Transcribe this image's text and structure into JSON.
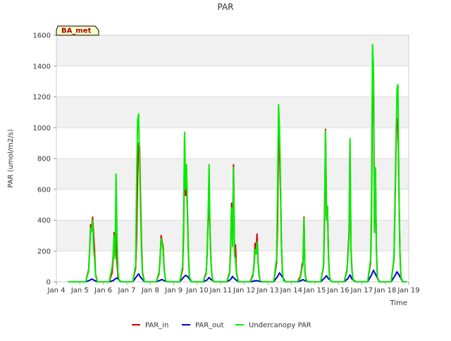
{
  "chart_data": {
    "type": "line",
    "title": "PAR",
    "xlabel": "Time",
    "ylabel": "PAR (umol/m2/s)",
    "site_tag": "BA_met",
    "xlim": [
      "Jan 4",
      "Jan 19"
    ],
    "ylim": [
      0,
      1600
    ],
    "x_ticks": [
      "Jan 4",
      "Jan 5",
      "Jan 6",
      "Jan 7",
      "Jan 8",
      "Jan 9",
      "Jan 10",
      "Jan 11",
      "Jan 12",
      "Jan 13",
      "Jan 14",
      "Jan 15",
      "Jan 16",
      "Jan 17",
      "Jan 18",
      "Jan 19"
    ],
    "y_ticks": [
      0,
      200,
      400,
      600,
      800,
      1000,
      1200,
      1400,
      1600
    ],
    "grid": true,
    "legend_position": "bottom",
    "series": [
      {
        "name": "PAR_in",
        "color": "#dd0000",
        "x": [
          "Jan 4 12:00",
          "Jan 4 18:00",
          "Jan 5 00:00",
          "Jan 5 06:00",
          "Jan 5 09:00",
          "Jan 5 10:00",
          "Jan 5 11:00",
          "Jan 5 12:00",
          "Jan 5 13:00",
          "Jan 5 14:00",
          "Jan 5 15:00",
          "Jan 5 16:00",
          "Jan 5 18:00",
          "Jan 6 06:00",
          "Jan 6 09:00",
          "Jan 6 10:00",
          "Jan 6 11:00",
          "Jan 6 12:00",
          "Jan 6 13:00",
          "Jan 6 14:00",
          "Jan 6 15:00",
          "Jan 6 16:00",
          "Jan 6 18:00",
          "Jan 7 06:00",
          "Jan 7 09:00",
          "Jan 7 10:00",
          "Jan 7 11:00",
          "Jan 7 12:00",
          "Jan 7 13:00",
          "Jan 7 14:00",
          "Jan 7 15:00",
          "Jan 7 16:00",
          "Jan 7 18:00",
          "Jan 8 06:00",
          "Jan 8 09:00",
          "Jan 8 10:00",
          "Jan 8 11:00",
          "Jan 8 12:00",
          "Jan 8 13:00",
          "Jan 8 14:00",
          "Jan 8 15:00",
          "Jan 8 16:00",
          "Jan 8 18:00",
          "Jan 9 06:00",
          "Jan 9 09:00",
          "Jan 9 10:00",
          "Jan 9 11:00",
          "Jan 9 12:00",
          "Jan 9 13:00",
          "Jan 9 14:00",
          "Jan 9 15:00",
          "Jan 9 16:00",
          "Jan 9 18:00",
          "Jan 10 06:00",
          "Jan 10 09:00",
          "Jan 10 10:00",
          "Jan 10 11:00",
          "Jan 10 12:00",
          "Jan 10 13:00",
          "Jan 10 14:00",
          "Jan 10 15:00",
          "Jan 10 16:00",
          "Jan 10 18:00",
          "Jan 11 06:00",
          "Jan 11 09:00",
          "Jan 11 10:00",
          "Jan 11 11:00",
          "Jan 11 12:00",
          "Jan 11 13:00",
          "Jan 11 14:00",
          "Jan 11 15:00",
          "Jan 11 16:00",
          "Jan 11 18:00",
          "Jan 12 06:00",
          "Jan 12 09:00",
          "Jan 12 10:00",
          "Jan 12 11:00",
          "Jan 12 12:00",
          "Jan 12 13:00",
          "Jan 12 14:00",
          "Jan 12 15:00",
          "Jan 12 16:00",
          "Jan 12 18:00",
          "Jan 13 06:00",
          "Jan 13 09:00",
          "Jan 13 10:00",
          "Jan 13 11:00",
          "Jan 13 12:00",
          "Jan 13 13:00",
          "Jan 13 14:00",
          "Jan 13 15:00",
          "Jan 13 16:00",
          "Jan 13 18:00",
          "Jan 14 06:00",
          "Jan 14 09:00",
          "Jan 14 10:00",
          "Jan 14 11:00",
          "Jan 14 12:00",
          "Jan 14 13:00",
          "Jan 14 14:00",
          "Jan 14 15:00",
          "Jan 14 16:00",
          "Jan 14 18:00",
          "Jan 15 06:00",
          "Jan 15 09:00",
          "Jan 15 10:00",
          "Jan 15 11:00",
          "Jan 15 12:00",
          "Jan 15 13:00",
          "Jan 15 14:00",
          "Jan 15 15:00",
          "Jan 15 16:00",
          "Jan 15 18:00",
          "Jan 16 06:00",
          "Jan 16 09:00",
          "Jan 16 10:00",
          "Jan 16 11:00",
          "Jan 16 12:00",
          "Jan 16 13:00",
          "Jan 16 14:00",
          "Jan 16 15:00",
          "Jan 16 16:00",
          "Jan 16 18:00",
          "Jan 17 06:00",
          "Jan 17 09:00",
          "Jan 17 10:00",
          "Jan 17 11:00",
          "Jan 17 12:00",
          "Jan 17 13:00",
          "Jan 17 14:00",
          "Jan 17 15:00",
          "Jan 17 16:00",
          "Jan 17 18:00",
          "Jan 18 06:00",
          "Jan 18 09:00",
          "Jan 18 10:00",
          "Jan 18 11:00",
          "Jan 18 12:00",
          "Jan 18 13:00",
          "Jan 18 14:00",
          "Jan 18 15:00",
          "Jan 18 16:00",
          "Jan 18 18:00",
          "Jan 18 22:00"
        ],
        "y": [
          0,
          0,
          0,
          0,
          80,
          210,
          370,
          340,
          420,
          310,
          200,
          50,
          0,
          0,
          60,
          150,
          320,
          170,
          310,
          120,
          30,
          10,
          0,
          0,
          90,
          300,
          680,
          900,
          880,
          540,
          250,
          60,
          0,
          0,
          60,
          160,
          300,
          260,
          230,
          100,
          30,
          5,
          0,
          0,
          80,
          320,
          940,
          560,
          680,
          420,
          160,
          30,
          0,
          0,
          60,
          170,
          400,
          500,
          330,
          130,
          40,
          5,
          0,
          0,
          60,
          220,
          510,
          260,
          760,
          200,
          240,
          60,
          0,
          0,
          50,
          120,
          250,
          200,
          310,
          150,
          50,
          10,
          0,
          0,
          120,
          380,
          950,
          850,
          600,
          230,
          60,
          10,
          0,
          0,
          30,
          60,
          110,
          130,
          420,
          60,
          20,
          5,
          0,
          0,
          100,
          400,
          990,
          420,
          490,
          180,
          40,
          10,
          0,
          0,
          80,
          200,
          310,
          900,
          220,
          80,
          20,
          5,
          0,
          0,
          120,
          420,
          1280,
          1360,
          340,
          720,
          200,
          30,
          0,
          0,
          150,
          500,
          860,
          1050,
          1060,
          600,
          200,
          30,
          0,
          0
        ]
      },
      {
        "name": "PAR_out",
        "color": "#0000cc",
        "x": [
          "Jan 4 12:00",
          "Jan 5 06:00",
          "Jan 5 10:00",
          "Jan 5 12:00",
          "Jan 5 14:00",
          "Jan 5 18:00",
          "Jan 6 06:00",
          "Jan 6 10:00",
          "Jan 6 12:00",
          "Jan 6 14:00",
          "Jan 6 18:00",
          "Jan 7 06:00",
          "Jan 7 10:00",
          "Jan 7 12:00",
          "Jan 7 14:00",
          "Jan 7 18:00",
          "Jan 8 06:00",
          "Jan 8 10:00",
          "Jan 8 12:00",
          "Jan 8 14:00",
          "Jan 8 18:00",
          "Jan 9 06:00",
          "Jan 9 10:00",
          "Jan 9 12:00",
          "Jan 9 14:00",
          "Jan 9 18:00",
          "Jan 10 06:00",
          "Jan 10 10:00",
          "Jan 10 12:00",
          "Jan 10 14:00",
          "Jan 10 18:00",
          "Jan 11 06:00",
          "Jan 11 10:00",
          "Jan 11 12:00",
          "Jan 11 14:00",
          "Jan 11 18:00",
          "Jan 12 06:00",
          "Jan 12 10:00",
          "Jan 12 12:00",
          "Jan 12 14:00",
          "Jan 12 18:00",
          "Jan 13 06:00",
          "Jan 13 10:00",
          "Jan 13 12:00",
          "Jan 13 14:00",
          "Jan 13 18:00",
          "Jan 14 06:00",
          "Jan 14 10:00",
          "Jan 14 12:00",
          "Jan 14 14:00",
          "Jan 14 18:00",
          "Jan 15 06:00",
          "Jan 15 10:00",
          "Jan 15 12:00",
          "Jan 15 14:00",
          "Jan 15 18:00",
          "Jan 16 06:00",
          "Jan 16 10:00",
          "Jan 16 12:00",
          "Jan 16 14:00",
          "Jan 16 18:00",
          "Jan 17 06:00",
          "Jan 17 10:00",
          "Jan 17 12:00",
          "Jan 17 14:00",
          "Jan 17 18:00",
          "Jan 18 06:00",
          "Jan 18 10:00",
          "Jan 18 12:00",
          "Jan 18 14:00",
          "Jan 18 18:00",
          "Jan 18 22:00"
        ],
        "y": [
          0,
          0,
          10,
          18,
          12,
          0,
          0,
          8,
          18,
          25,
          0,
          0,
          35,
          52,
          30,
          0,
          0,
          10,
          15,
          8,
          0,
          0,
          30,
          42,
          35,
          0,
          0,
          12,
          28,
          15,
          0,
          0,
          15,
          35,
          20,
          0,
          0,
          5,
          8,
          6,
          0,
          0,
          35,
          58,
          40,
          0,
          0,
          8,
          14,
          8,
          0,
          0,
          25,
          40,
          20,
          0,
          0,
          22,
          45,
          18,
          0,
          0,
          45,
          75,
          50,
          0,
          0,
          40,
          65,
          45,
          0,
          0
        ]
      },
      {
        "name": "Undercanopy PAR",
        "color": "#00ee00",
        "x": [
          "Jan 4 12:00",
          "Jan 4 18:00",
          "Jan 5 00:00",
          "Jan 5 06:00",
          "Jan 5 09:00",
          "Jan 5 10:00",
          "Jan 5 11:00",
          "Jan 5 12:00",
          "Jan 5 13:00",
          "Jan 5 14:00",
          "Jan 5 15:00",
          "Jan 5 16:00",
          "Jan 5 18:00",
          "Jan 6 06:00",
          "Jan 6 09:00",
          "Jan 6 10:00",
          "Jan 6 11:00",
          "Jan 6 12:00",
          "Jan 6 13:00",
          "Jan 6 14:00",
          "Jan 6 15:00",
          "Jan 6 16:00",
          "Jan 6 18:00",
          "Jan 7 06:00",
          "Jan 7 09:00",
          "Jan 7 10:00",
          "Jan 7 11:00",
          "Jan 7 12:00",
          "Jan 7 13:00",
          "Jan 7 14:00",
          "Jan 7 15:00",
          "Jan 7 16:00",
          "Jan 7 18:00",
          "Jan 8 06:00",
          "Jan 8 09:00",
          "Jan 8 10:00",
          "Jan 8 11:00",
          "Jan 8 12:00",
          "Jan 8 13:00",
          "Jan 8 14:00",
          "Jan 8 15:00",
          "Jan 8 16:00",
          "Jan 8 18:00",
          "Jan 9 06:00",
          "Jan 9 09:00",
          "Jan 9 10:00",
          "Jan 9 11:00",
          "Jan 9 12:00",
          "Jan 9 13:00",
          "Jan 9 14:00",
          "Jan 9 15:00",
          "Jan 9 16:00",
          "Jan 9 18:00",
          "Jan 10 06:00",
          "Jan 10 09:00",
          "Jan 10 10:00",
          "Jan 10 11:00",
          "Jan 10 12:00",
          "Jan 10 13:00",
          "Jan 10 14:00",
          "Jan 10 15:00",
          "Jan 10 16:00",
          "Jan 10 18:00",
          "Jan 11 06:00",
          "Jan 11 09:00",
          "Jan 11 10:00",
          "Jan 11 11:00",
          "Jan 11 12:00",
          "Jan 11 13:00",
          "Jan 11 14:00",
          "Jan 11 15:00",
          "Jan 11 16:00",
          "Jan 11 18:00",
          "Jan 12 06:00",
          "Jan 12 09:00",
          "Jan 12 10:00",
          "Jan 12 11:00",
          "Jan 12 12:00",
          "Jan 12 13:00",
          "Jan 12 14:00",
          "Jan 12 15:00",
          "Jan 12 16:00",
          "Jan 12 18:00",
          "Jan 13 06:00",
          "Jan 13 09:00",
          "Jan 13 10:00",
          "Jan 13 11:00",
          "Jan 13 12:00",
          "Jan 13 13:00",
          "Jan 13 14:00",
          "Jan 13 15:00",
          "Jan 13 16:00",
          "Jan 13 18:00",
          "Jan 14 06:00",
          "Jan 14 09:00",
          "Jan 14 10:00",
          "Jan 14 11:00",
          "Jan 14 12:00",
          "Jan 14 13:00",
          "Jan 14 14:00",
          "Jan 14 15:00",
          "Jan 14 16:00",
          "Jan 14 18:00",
          "Jan 15 06:00",
          "Jan 15 09:00",
          "Jan 15 10:00",
          "Jan 15 11:00",
          "Jan 15 12:00",
          "Jan 15 13:00",
          "Jan 15 14:00",
          "Jan 15 15:00",
          "Jan 15 16:00",
          "Jan 15 18:00",
          "Jan 16 06:00",
          "Jan 16 09:00",
          "Jan 16 10:00",
          "Jan 16 11:00",
          "Jan 16 12:00",
          "Jan 16 13:00",
          "Jan 16 14:00",
          "Jan 16 15:00",
          "Jan 16 16:00",
          "Jan 16 18:00",
          "Jan 17 06:00",
          "Jan 17 09:00",
          "Jan 17 10:00",
          "Jan 17 11:00",
          "Jan 17 12:00",
          "Jan 17 13:00",
          "Jan 17 14:00",
          "Jan 17 15:00",
          "Jan 17 16:00",
          "Jan 17 18:00",
          "Jan 18 06:00",
          "Jan 18 09:00",
          "Jan 18 10:00",
          "Jan 18 11:00",
          "Jan 18 12:00",
          "Jan 18 13:00",
          "Jan 18 14:00",
          "Jan 18 15:00",
          "Jan 18 16:00",
          "Jan 18 18:00",
          "Jan 18 22:00"
        ],
        "y": [
          0,
          0,
          0,
          0,
          70,
          200,
          350,
          330,
          400,
          220,
          150,
          40,
          0,
          0,
          100,
          180,
          300,
          150,
          700,
          280,
          60,
          10,
          0,
          0,
          110,
          660,
          1050,
          1090,
          800,
          450,
          200,
          50,
          0,
          0,
          50,
          150,
          280,
          250,
          200,
          90,
          30,
          5,
          0,
          0,
          100,
          400,
          970,
          600,
          760,
          460,
          180,
          30,
          0,
          0,
          50,
          180,
          420,
          760,
          320,
          120,
          40,
          5,
          0,
          0,
          50,
          200,
          480,
          230,
          740,
          170,
          150,
          50,
          0,
          0,
          40,
          110,
          210,
          180,
          260,
          140,
          40,
          10,
          0,
          0,
          150,
          600,
          1150,
          1000,
          630,
          240,
          60,
          10,
          0,
          0,
          20,
          50,
          90,
          110,
          410,
          50,
          15,
          5,
          0,
          0,
          110,
          500,
          980,
          400,
          490,
          160,
          40,
          10,
          0,
          0,
          70,
          180,
          280,
          930,
          200,
          70,
          20,
          5,
          0,
          0,
          140,
          520,
          1540,
          1380,
          320,
          740,
          210,
          30,
          0,
          0,
          160,
          550,
          900,
          1250,
          1280,
          620,
          200,
          30,
          0,
          0
        ]
      }
    ]
  }
}
